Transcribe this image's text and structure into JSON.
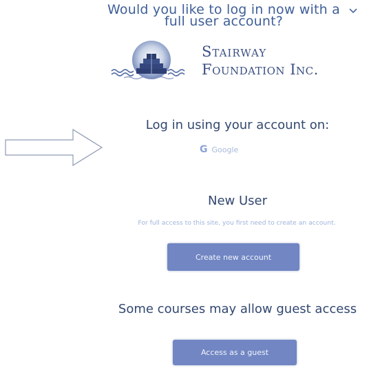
{
  "prompt": {
    "text": "Would you like to log in now with a full user account?"
  },
  "logo": {
    "line1": "Stairway",
    "line2": "Foundation Inc."
  },
  "login": {
    "heading": "Log in using your account on:",
    "google_label": "Google",
    "google_icon": "G"
  },
  "new_user": {
    "heading": "New User",
    "description": "For full access to this site, you first need to create an account.",
    "button_label": "Create new account"
  },
  "guest": {
    "heading": "Some courses may allow guest access",
    "button_label": "Access as a guest"
  },
  "colors": {
    "heading": "#32476f",
    "accent": "#7186c3",
    "link": "#a7b9d9"
  },
  "icons": {
    "chevron": "chevron-down-icon",
    "arrow": "arrow-right-outline",
    "google": "google-icon"
  }
}
